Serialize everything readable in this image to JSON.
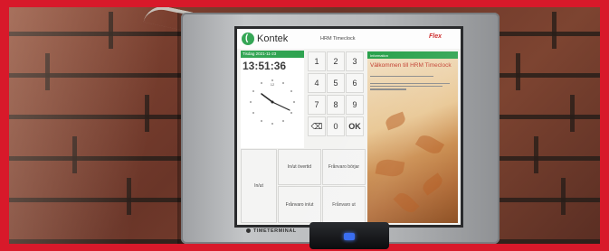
{
  "topbar": {
    "brand": "Kontek",
    "app_title": "HRM Timeclock",
    "partner_logo": "Flex"
  },
  "clock": {
    "date_label": "Tisdag 2021-11-23",
    "time": "13:51:36",
    "dial_number": "12"
  },
  "keypad": {
    "keys": [
      "1",
      "2",
      "3",
      "4",
      "5",
      "6",
      "7",
      "8",
      "9",
      "⌫",
      "0",
      "OK"
    ]
  },
  "info": {
    "header": "Information",
    "welcome": "Välkommen till HRM Timeclock"
  },
  "actions": {
    "in": "In/ut",
    "in_overtime": "In/ut övertid",
    "absence_in": "Frånvaro in/ut",
    "presence_begins": "Frånvaro börjar",
    "absence_out": "Frånvaro ut"
  },
  "hardware": {
    "bottom_brand": "TIMETERMINAL"
  },
  "colors": {
    "frame": "#d8192a",
    "accent_green": "#27a04a",
    "welcome_red": "#c0392b"
  }
}
